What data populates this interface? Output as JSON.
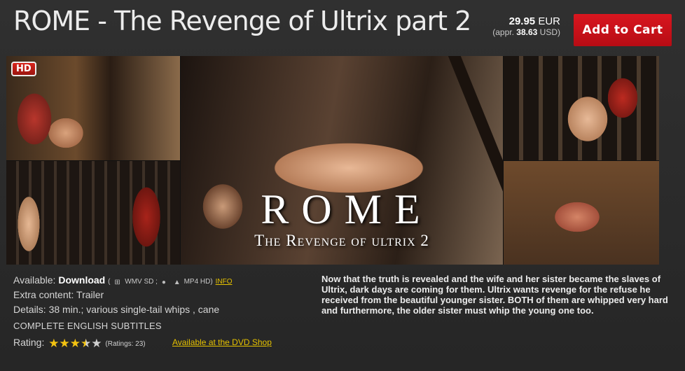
{
  "product": {
    "title": "ROME - The Revenge of Ultrix part 2"
  },
  "price": {
    "amount": "29.95",
    "currency": "EUR",
    "approx_prefix": "(appr.",
    "approx_amount": "38.63",
    "approx_suffix": "USD)"
  },
  "cart": {
    "button_label": "Add to Cart"
  },
  "collage": {
    "hd_badge": "HD",
    "overlay_title": "ROME",
    "overlay_subtitle": "The Revenge of ultrix 2"
  },
  "details": {
    "available_label": "Available:",
    "available_value": "Download",
    "format_open": "(",
    "format_wmv": "WMV SD ;",
    "format_mp4": "MP4 HD)",
    "info_link": "INFO",
    "extra_label": "Extra content:",
    "extra_value": "Trailer",
    "details_label": "Details:",
    "details_value": "38 min.; various single-tail whips , cane",
    "subtitles": "COMPLETE ENGLISH SUBTITLES",
    "rating_label": "Rating:",
    "rating_value": 3.5,
    "rating_max": 5,
    "ratings_count": "(Ratings: 23)",
    "dvd_link": "Available at the DVD Shop"
  },
  "description": "Now that the truth is revealed and the wife and her sister became the slaves of Ultrix, dark days are coming for them. Ultrix wants revenge for the refuse he received from the beautiful younger sister. BOTH of them are whipped very hard and furthermore, the older sister must whip the young one too.",
  "colors": {
    "background": "#2b2b2b",
    "cart_button": "#c8101a",
    "link": "#e6c200",
    "star_filled": "#f3c311",
    "star_empty": "#cfcfcf"
  },
  "icons": [
    "windows-icon",
    "apple-icon",
    "android-icon",
    "star-icon"
  ]
}
